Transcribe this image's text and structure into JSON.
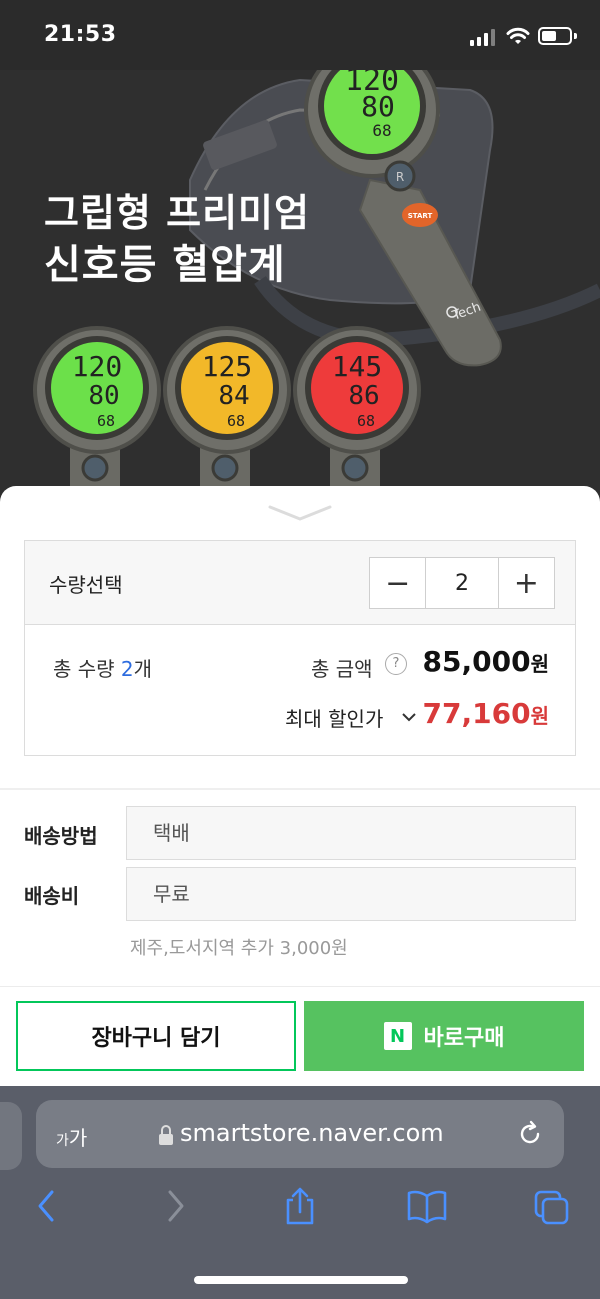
{
  "status_bar": {
    "time": "21:53"
  },
  "banner": {
    "headline_line1": "그립형 프리미엄",
    "headline_line2": "신호등 혈압계",
    "device_brand": "Tech",
    "device_start_label": "START",
    "device_r_label": "R",
    "main_display": [
      "120",
      "80",
      "68"
    ],
    "displays": [
      {
        "color": "#6ce04a",
        "values": [
          "120",
          "80",
          "68"
        ]
      },
      {
        "color": "#f2b829",
        "values": [
          "125",
          "84",
          "68"
        ]
      },
      {
        "color": "#ee3b3b",
        "values": [
          "145",
          "86",
          "68"
        ]
      }
    ]
  },
  "order": {
    "quantity_label": "수량선택",
    "quantity_value": "2",
    "minus_label": "−",
    "plus_label": "+",
    "total_qty_prefix": "총 수량 ",
    "total_qty_value": "2",
    "total_qty_suffix": "개",
    "total_amount_label": "총 금액",
    "help_label": "?",
    "total_amount": "85,000",
    "currency": "원",
    "max_discount_label": "최대 할인가",
    "discount_price": "77,160"
  },
  "shipping": {
    "method_label": "배송방법",
    "method_value": "택배",
    "fee_label": "배송비",
    "fee_value": "무료",
    "note": "제주,도서지역 추가 3,000원"
  },
  "actions": {
    "cart_label": "장바구니 담기",
    "buy_label": "바로구매",
    "buy_icon_letter": "N"
  },
  "browser": {
    "aa_small": "가",
    "aa_large": "가",
    "url": "smartstore.naver.com"
  },
  "colors": {
    "accent_green": "#03c75a",
    "buy_green": "#56c260",
    "discount_red": "#d83a3a",
    "qty_blue": "#2d6cdf"
  }
}
